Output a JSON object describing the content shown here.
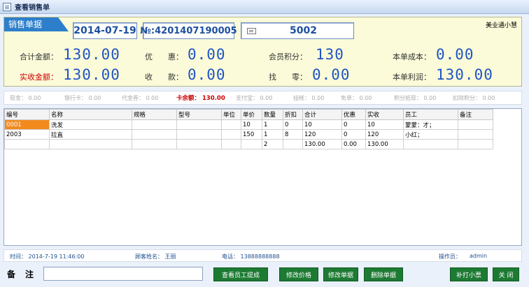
{
  "window": {
    "title": "查看销售单"
  },
  "header": {
    "tab_label": "销售单据",
    "date": "2014-07-19",
    "receipt_no": "№:4201407190005",
    "card_number": "5002",
    "shop_name": "美业通小慧"
  },
  "summary": {
    "total_amount_label": "合计金额：",
    "total_amount": "130.00",
    "discount_label": "优　　惠：",
    "discount": "0.00",
    "points_label": "会员积分：",
    "points": "130",
    "cost_label": "本单成本：",
    "cost": "0.00",
    "actual_amount_label": "实收金额：",
    "actual_amount": "130.00",
    "received_label": "收　　款：",
    "received": "0.00",
    "change_label": "找　　零：",
    "change": "0.00",
    "profit_label": "本单利润：",
    "profit": "130.00"
  },
  "payments": {
    "cash": "现金： 0.00",
    "bank_card": "银行卡： 0.00",
    "voucher": "代金券： 0.00",
    "card_balance": "卡余额： 130.00",
    "alipay": "支付宝： 0.00",
    "credit": "挂帐： 0.00",
    "free": "免单： 0.00",
    "points_cash": "积分抵现： 0.00",
    "deduct_points": "扣除积分： 0.00"
  },
  "table": {
    "columns": [
      "编号",
      "名称",
      "规格",
      "型号",
      "单位",
      "单价",
      "数量",
      "折扣",
      "合计",
      "优惠",
      "实收",
      "员工",
      "备注"
    ],
    "rows": [
      [
        "0001",
        "洗发",
        "",
        "",
        "",
        "10",
        "1",
        "0",
        "10",
        "0",
        "10",
        "蒙蒙：才；",
        ""
      ],
      [
        "2003",
        "拉直",
        "",
        "",
        "",
        "150",
        "1",
        "8",
        "120",
        "0",
        "120",
        "小红；",
        ""
      ],
      [
        "",
        "",
        "",
        "",
        "",
        "",
        "2",
        "",
        "130.00",
        "0.00",
        "130.00",
        "",
        ""
      ]
    ]
  },
  "footer": {
    "time": "时间： 2014-7-19 11:46:00",
    "customer": "顾客姓名： 王丽",
    "phone": "电话： 13888888888",
    "operator_label": "操作员：",
    "operator": "admin"
  },
  "actions": {
    "note_label": "备注",
    "note_value": "",
    "view_commission": "查看员工提成",
    "edit_price": "修改价格",
    "edit_receipt": "修改单据",
    "delete_receipt": "删除单据",
    "reprint": "补打小票",
    "close": "关 闭"
  },
  "colors": {
    "accent": "#2d7fcb",
    "value_blue": "#1f55c4",
    "button_green": "#1d7a33",
    "selected_cell": "#f28a1e"
  }
}
